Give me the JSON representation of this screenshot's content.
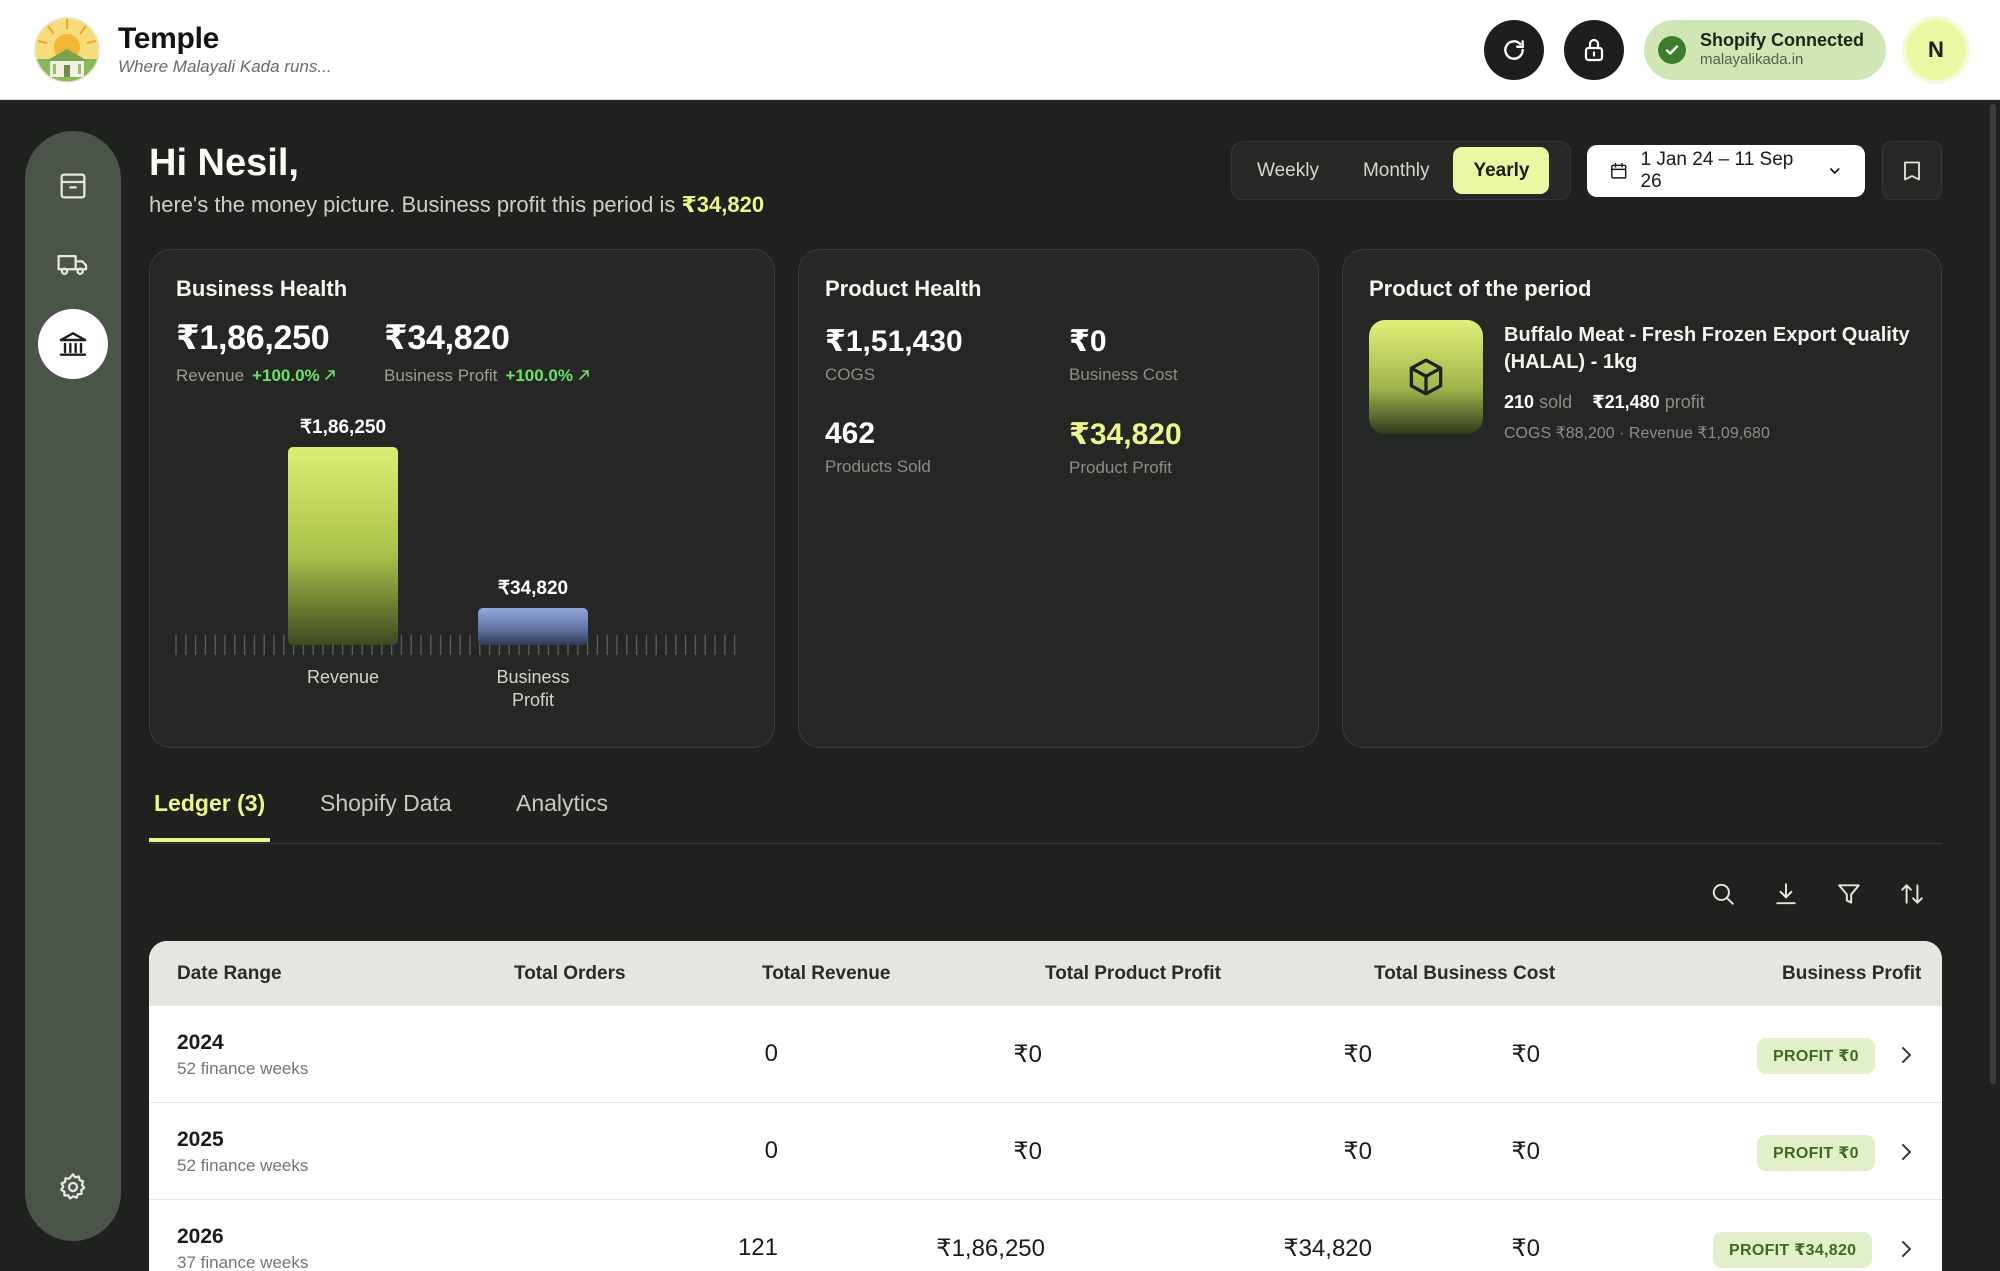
{
  "brand": {
    "name": "Temple",
    "tagline": "Where Malayali Kada runs..."
  },
  "header": {
    "shopify_status": "Shopify Connected",
    "shopify_domain": "malayalikada.in",
    "avatar_initial": "N"
  },
  "greeting": {
    "title": "Hi Nesil,",
    "subtitle": "here's the money picture. Business profit this period is",
    "profit": "₹34,820"
  },
  "period": {
    "options": [
      "Weekly",
      "Monthly",
      "Yearly"
    ],
    "selected": "Yearly",
    "date_range": "1 Jan 24 – 11 Sep 26"
  },
  "business_health": {
    "title": "Business Health",
    "revenue_value": "₹1,86,250",
    "revenue_label": "Revenue",
    "revenue_change": "+100.0%",
    "profit_value": "₹34,820",
    "profit_label": "Business Profit",
    "profit_change": "+100.0%"
  },
  "chart_data": {
    "type": "bar",
    "categories": [
      "Revenue",
      "Business Profit"
    ],
    "values": [
      186250,
      34820
    ],
    "data_labels": [
      "₹1,86,250",
      "₹34,820"
    ],
    "colors": [
      "#d6e96d",
      "#8ea2d8"
    ]
  },
  "product_health": {
    "title": "Product Health",
    "cogs_value": "₹1,51,430",
    "cogs_label": "COGS",
    "business_cost_value": "₹0",
    "business_cost_label": "Business Cost",
    "products_sold_value": "462",
    "products_sold_label": "Products Sold",
    "product_profit_value": "₹34,820",
    "product_profit_label": "Product Profit"
  },
  "product_of_period": {
    "title": "Product of the period",
    "name": "Buffalo Meat - Fresh Frozen Export Quality (HALAL) - 1kg",
    "sold_count": "210",
    "sold_label": "sold",
    "profit_value": "₹21,480",
    "profit_label": "profit",
    "details": "COGS ₹88,200 · Revenue ₹1,09,680"
  },
  "tabs": [
    {
      "label": "Ledger (3)"
    },
    {
      "label": "Shopify Data"
    },
    {
      "label": "Analytics"
    }
  ],
  "table": {
    "columns": [
      "Date Range",
      "Total Orders",
      "Total Revenue",
      "Total Product Profit",
      "Total Business Cost",
      "Business Profit"
    ],
    "rows": [
      {
        "year": "2024",
        "weeks": "52 finance weeks",
        "orders": "0",
        "revenue": "₹0",
        "product_profit": "₹0",
        "business_cost": "₹0",
        "badge": "PROFIT ₹0"
      },
      {
        "year": "2025",
        "weeks": "52 finance weeks",
        "orders": "0",
        "revenue": "₹0",
        "product_profit": "₹0",
        "business_cost": "₹0",
        "badge": "PROFIT ₹0"
      },
      {
        "year": "2026",
        "weeks": "37 finance weeks",
        "orders": "121",
        "revenue": "₹1,86,250",
        "product_profit": "₹34,820",
        "business_cost": "₹0",
        "badge": "PROFIT ₹34,820"
      }
    ]
  },
  "colors": {
    "accent": "#eef58d",
    "positive": "#6fe06a",
    "dark": "#1f211f",
    "rail": "#4a5449"
  }
}
